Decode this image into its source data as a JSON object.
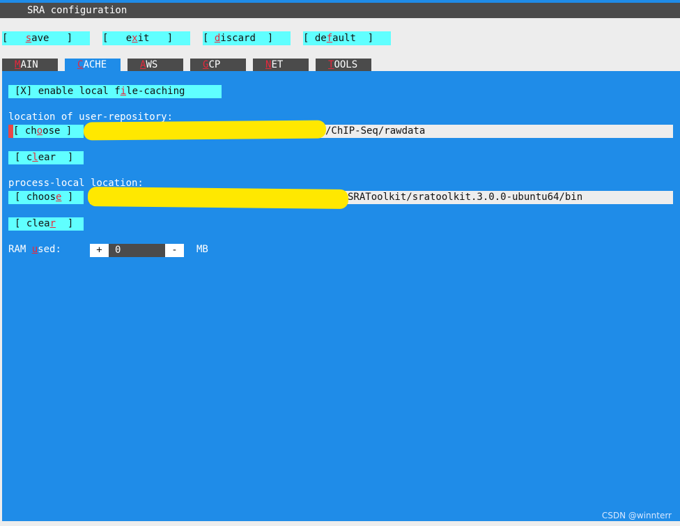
{
  "window": {
    "title": "SRA configuration"
  },
  "toolbar": {
    "save": {
      "pre": "[   ",
      "hk": "s",
      "post": "ave   ]"
    },
    "exit": {
      "pre": "[   e",
      "hk": "x",
      "post": "it   ]"
    },
    "discard": {
      "pre": "[ ",
      "hk": "d",
      "post": "iscard  ]"
    },
    "default": {
      "pre": "[ de",
      "hk": "f",
      "post": "ault  ]"
    }
  },
  "tabs": [
    {
      "pre": "",
      "hk": "M",
      "post": "AIN"
    },
    {
      "pre": "",
      "hk": "C",
      "post": "ACHE"
    },
    {
      "pre": "",
      "hk": "A",
      "post": "WS"
    },
    {
      "pre": "",
      "hk": "G",
      "post": "CP"
    },
    {
      "pre": "",
      "hk": "N",
      "post": "ET"
    },
    {
      "pre": "",
      "hk": "T",
      "post": "OOLS"
    }
  ],
  "cache": {
    "enable_caching": {
      "pre": "[X] enable local f",
      "hk": "i",
      "post": "le-caching"
    },
    "user_repo": {
      "label": "location of user-repository:",
      "choose": {
        "pre": "[ ch",
        "hk": "o",
        "post": "ose ]"
      },
      "path": "/ChIP-Seq/rawdata",
      "clear": {
        "pre": "[ c",
        "hk": "l",
        "post": "ear  ]"
      }
    },
    "process_local": {
      "label": "process-local location:",
      "choose": {
        "pre": "[ choos",
        "hk": "e",
        "post": " ]"
      },
      "path": "SRAToolkit/sratoolkit.3.0.0-ubuntu64/bin",
      "clear": {
        "pre": "[ clea",
        "hk": "r",
        "post": "  ]"
      }
    },
    "ram": {
      "label_pre": "RAM ",
      "label_hk": "u",
      "label_post": "sed:",
      "plus": "+",
      "value": "0",
      "minus": "-",
      "unit": "MB"
    }
  },
  "watermark": "CSDN @winnterr",
  "colors": {
    "panel": "#1f8ce8",
    "button": "#60ffff",
    "hotkey": "#e8283c",
    "titlebar": "#4b4b4b",
    "redaction": "#ffe800"
  }
}
